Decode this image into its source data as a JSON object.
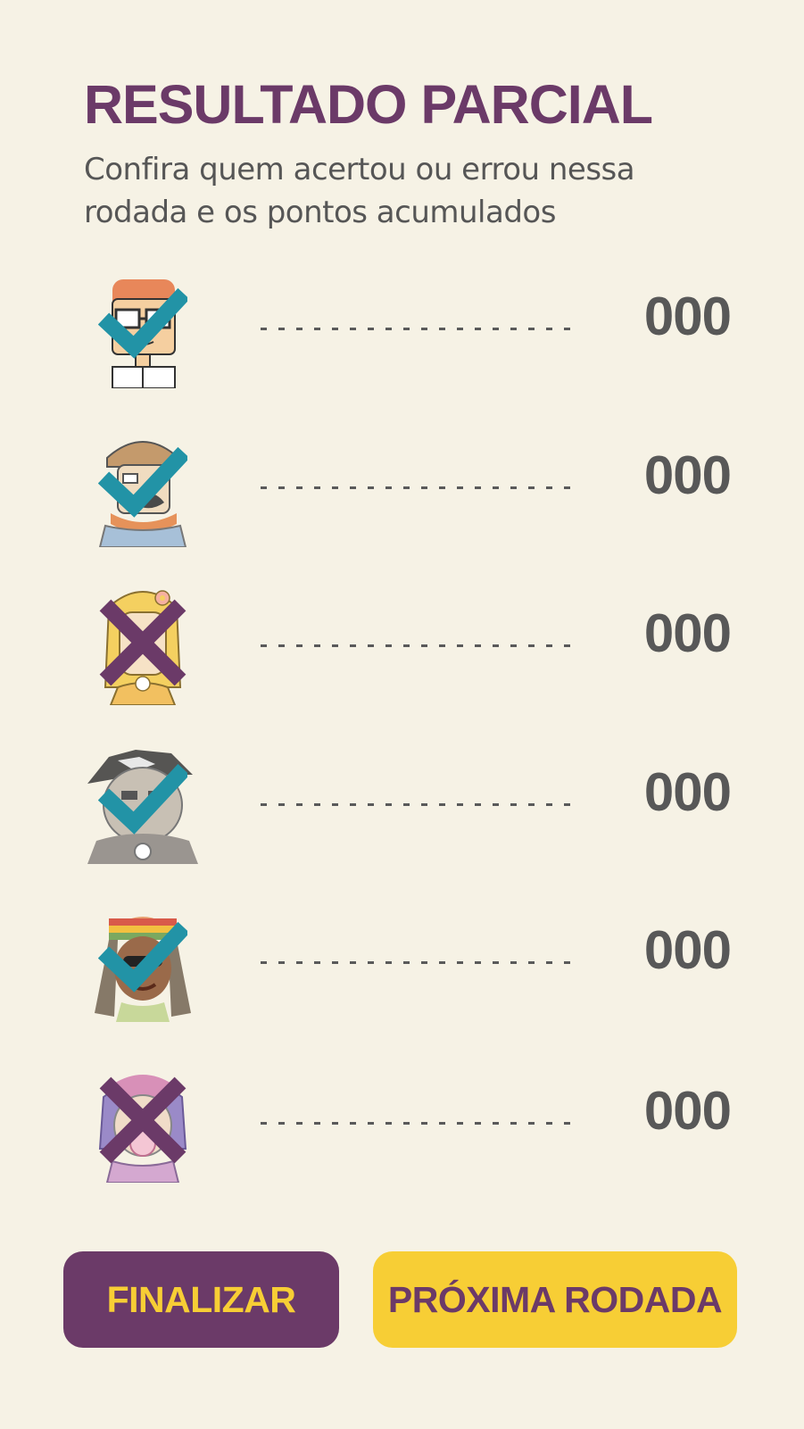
{
  "header": {
    "title": "RESULTADO PARCIAL",
    "subtitle": "Confira quem acertou ou errou nessa rodada e os pontos acumulados"
  },
  "players": [
    {
      "avatar": "nerd-glasses-avatar",
      "result": "correct",
      "score": "000"
    },
    {
      "avatar": "hat-scarf-avatar",
      "result": "correct",
      "score": "000"
    },
    {
      "avatar": "blonde-girl-avatar",
      "result": "wrong",
      "score": "000"
    },
    {
      "avatar": "goth-avatar",
      "result": "correct",
      "score": "000"
    },
    {
      "avatar": "rasta-avatar",
      "result": "correct",
      "score": "000"
    },
    {
      "avatar": "bubblegum-avatar",
      "result": "wrong",
      "score": "000"
    }
  ],
  "buttons": {
    "finalizar": "FINALIZAR",
    "proxima": "PRÓXIMA RODADA"
  },
  "colors": {
    "background": "#f6f2e5",
    "purple": "#6b3a68",
    "yellow": "#f7ce35",
    "teal": "#2293a6",
    "text_gray": "#585858"
  }
}
